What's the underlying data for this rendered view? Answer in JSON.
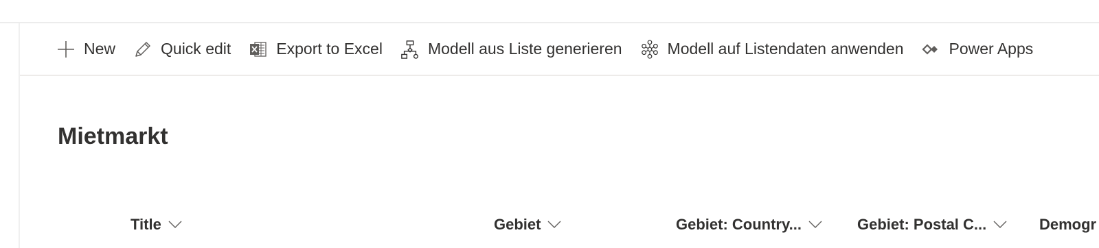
{
  "commands": [
    {
      "label": "New",
      "icon": "plus-icon"
    },
    {
      "label": "Quick edit",
      "icon": "pencil-icon"
    },
    {
      "label": "Export to Excel",
      "icon": "excel-icon"
    },
    {
      "label": "Modell aus Liste generieren",
      "icon": "model-flow-icon"
    },
    {
      "label": "Modell auf Listendaten anwenden",
      "icon": "model-apply-icon"
    },
    {
      "label": "Power Apps",
      "icon": "power-apps-icon"
    }
  ],
  "page": {
    "title": "Mietmarkt"
  },
  "columns": [
    {
      "label": "Title",
      "icon": "chevron-down-icon"
    },
    {
      "label": "Gebiet",
      "icon": "chevron-down-icon"
    },
    {
      "label": "Gebiet: Country...",
      "icon": "chevron-down-icon"
    },
    {
      "label": "Gebiet: Postal C...",
      "icon": "chevron-down-icon"
    },
    {
      "label": "Demogr",
      "icon": "chevron-down-icon"
    }
  ]
}
